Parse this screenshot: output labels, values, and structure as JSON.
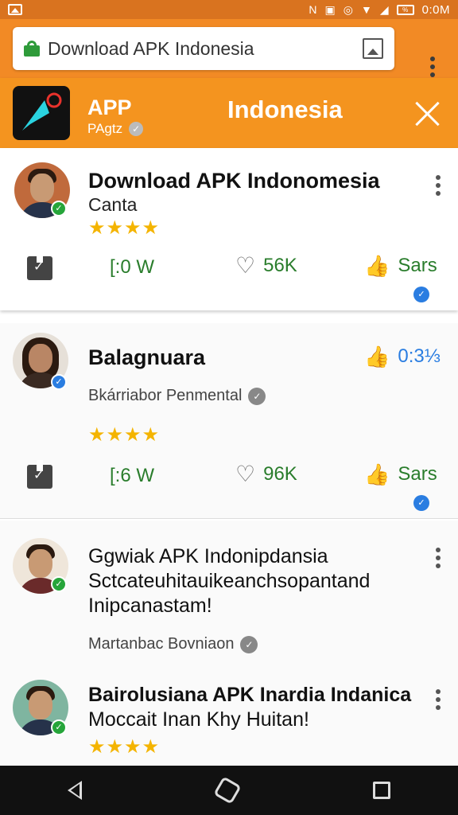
{
  "status_bar": {
    "time": "0:0M",
    "battery": "%"
  },
  "browser": {
    "url": "Download APK Indonesia"
  },
  "app_banner": {
    "app_name": "APP",
    "app_sub": "PAgtz",
    "title": "Indonesia",
    "colors": {
      "banner": "#f4941f",
      "browser": "#f28a25",
      "status": "#d9731f"
    }
  },
  "posts": [
    {
      "title": "Download APK Indonomesia",
      "subtitle": "Canta",
      "stars": "★★★★",
      "actions": {
        "views": "[:0 W",
        "likes": "56K",
        "share": "Sars"
      }
    },
    {
      "title": "Balagnuara",
      "author": "Bkárriabor Penmental",
      "stars": "★★★★",
      "rating": "0:3⅓",
      "actions": {
        "views": "[:6 W",
        "likes": "96K",
        "share": "Sars"
      }
    },
    {
      "lines": [
        "Ggwiak APK Indonipdansia",
        "Sctcateuhitauikeanchsopantand",
        "Inipcanastam!"
      ],
      "author": "Martanbac Bovniaon"
    },
    {
      "lines": [
        "Bairolusiana APK Inardia Indanica",
        "Moccait Inan Khy Huitan!"
      ],
      "stars": "★★★★"
    }
  ]
}
